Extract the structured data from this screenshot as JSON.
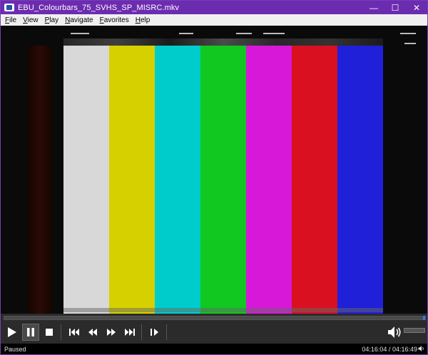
{
  "window": {
    "title": "EBU_Colourbars_75_SVHS_SP_MISRC.mkv",
    "minimize": "—",
    "maximize": "☐",
    "close": "✕"
  },
  "menu": {
    "items": [
      {
        "key": "F",
        "rest": "ile"
      },
      {
        "key": "V",
        "rest": "iew"
      },
      {
        "key": "P",
        "rest": "lay"
      },
      {
        "key": "N",
        "rest": "avigate"
      },
      {
        "key": "F",
        "rest": "avorites"
      },
      {
        "key": "H",
        "rest": "elp"
      }
    ]
  },
  "video": {
    "bars": [
      "#d8d8d8",
      "#d6d000",
      "#00cccc",
      "#10c820",
      "#d818d8",
      "#d81020",
      "#2020d8"
    ],
    "left_bar": "#2a0a04"
  },
  "playback": {
    "progress": 0.998,
    "volume": 0.0
  },
  "status": {
    "state": "Paused",
    "position": "04:16:04",
    "duration": "04:16:49",
    "separator": "/"
  },
  "colors": {
    "titlebar": "#6c2cb0",
    "seek_thumb": "#3a7ad8"
  }
}
